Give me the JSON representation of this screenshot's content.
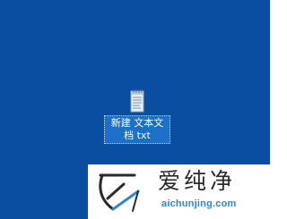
{
  "desktop": {
    "background_color": "#0a4ea1",
    "file": {
      "icon": "text-document-icon",
      "label_line1": "新建 文本文",
      "label_line2": "档 txt"
    }
  },
  "watermark": {
    "logo_icon": "aichunjing-logo-icon",
    "title": "爱纯净",
    "domain": "aichunjing.com",
    "accent_color": "#2f86d6"
  }
}
